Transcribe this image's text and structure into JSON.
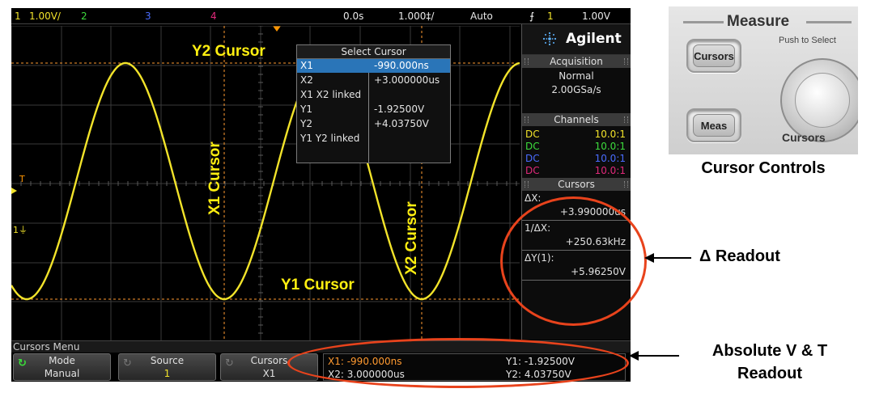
{
  "topbar": {
    "ch1_num": "1",
    "ch1_scale": "1.00V/",
    "ch2_num": "2",
    "ch3_num": "3",
    "ch4_num": "4",
    "time_offset": "0.0s",
    "time_scale": "1.000‡/",
    "trigger_mode": "Auto",
    "trigger_slope_icon": "rising-edge-icon",
    "trigger_source": "1",
    "trigger_level": "1.00V"
  },
  "overlay_labels": {
    "y2": "Y2 Cursor",
    "y1": "Y1 Cursor",
    "x1": "X1 Cursor",
    "x2": "X2 Cursor"
  },
  "popup": {
    "title": "Select Cursor",
    "items": [
      {
        "label": "X1",
        "value": "-990.000ns",
        "selected": true
      },
      {
        "label": "X2",
        "value": "+3.000000us",
        "selected": false
      },
      {
        "label": "X1 X2 linked",
        "value": "",
        "selected": false
      },
      {
        "label": "Y1",
        "value": "-1.92500V",
        "selected": false
      },
      {
        "label": "Y2",
        "value": "+4.03750V",
        "selected": false
      },
      {
        "label": "Y1 Y2 linked",
        "value": "",
        "selected": false
      }
    ]
  },
  "panel": {
    "brand": "Agilent",
    "acquisition_title": "Acquisition",
    "acquisition_mode": "Normal",
    "sample_rate": "2.00GSa/s",
    "channels_title": "Channels",
    "channels": [
      {
        "coupling": "DC",
        "probe": "10.0:1",
        "color": "#f2e32a"
      },
      {
        "coupling": "DC",
        "probe": "10.0:1",
        "color": "#3ddc3d"
      },
      {
        "coupling": "DC",
        "probe": "10.0:1",
        "color": "#4a6cff"
      },
      {
        "coupling": "DC",
        "probe": "10.0:1",
        "color": "#e0297a"
      }
    ],
    "cursors_title": "Cursors",
    "delta_x_label": "ΔX:",
    "delta_x_value": "+3.990000us",
    "inv_delta_x_label": "1/ΔX:",
    "inv_delta_x_value": "+250.63kHz",
    "delta_y_label": "ΔY(1):",
    "delta_y_value": "+5.96250V"
  },
  "menu": {
    "title": "Cursors Menu",
    "mode_label": "Mode",
    "mode_value": "Manual",
    "source_label": "Source",
    "source_value": "1",
    "cursors_label": "Cursors",
    "cursors_value": "X1"
  },
  "readout": {
    "x1": "X1: -990.000ns",
    "x2": "X2: 3.000000us",
    "y1": "Y1: -1.92500V",
    "y2": "Y2: 4.03750V"
  },
  "photo": {
    "heading": "Measure",
    "sub": "Push to Select",
    "cursors_btn": "Cursors",
    "meas_btn": "Meas",
    "knob_label": "Cursors"
  },
  "annotations": {
    "cursor_controls": "Cursor Controls",
    "delta_readout": "Δ Readout",
    "absolute_line1": "Absolute V & T",
    "absolute_line2": "Readout"
  },
  "colors": {
    "trace": "#f2e32a",
    "cursor_line": "#ff9a30",
    "annotation_red": "#e8431c"
  }
}
